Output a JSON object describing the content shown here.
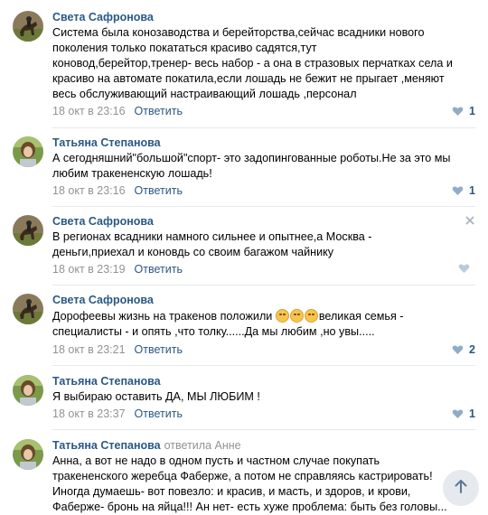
{
  "comments": [
    {
      "author": "Света Сафронова",
      "reply_to": "",
      "lines": [
        "Система была конозаводства и берейторства,сейчас всадники нового",
        "поколения только покататься красиво садятся,тут",
        "коновод,берейтор,тренер- весь набор - а она в стразовых перчатках села и",
        "красиво на автомате покатила,если лошадь не бежит не прыгает ,меняют",
        "весь обслуживающий настраивающий лошадь ,персонал"
      ],
      "date": "18 окт в 23:16",
      "reply_label": "Ответить",
      "likes": "1"
    },
    {
      "author": "Татьяна Степанова",
      "reply_to": "",
      "lines": [
        "А сегодняшний\"большой\"спорт- это задопингованные роботы.Не за это мы",
        "любим тракененскую лошадь!"
      ],
      "date": "18 окт в 23:16",
      "reply_label": "Ответить",
      "likes": "1"
    },
    {
      "author": "Света Сафронова",
      "reply_to": "",
      "lines": [
        "В регионах всадники намного сильнее и опытнее,а Москва -",
        "деньги,приехал и коновдь со своим багажом чайнику"
      ],
      "date": "18 окт в 23:19",
      "reply_label": "Ответить",
      "likes": ""
    },
    {
      "author": "Света Сафронова",
      "reply_to": "",
      "line1_before": "Дорофеевы жизнь на тракенов положили ",
      "line1_after": "великая семья -",
      "lines": [
        "специалисты - и опять ,что толку......Да мы любим ,но увы....."
      ],
      "date": "18 окт в 23:21",
      "reply_label": "Ответить",
      "likes": "2"
    },
    {
      "author": "Татьяна Степанова",
      "reply_to": "",
      "lines": [
        "Я выбираю оставить ДА, МЫ ЛЮБИМ !"
      ],
      "date": "18 окт в 23:37",
      "reply_label": "Ответить",
      "likes": "1"
    },
    {
      "author": "Татьяна Степанова",
      "reply_to": "ответила Анне",
      "lines": [
        "Анна, а вот не надо в одном пусть и частном случае покупать",
        "тракененского жеребца Фаберже, а потом не справляясь кастрировать!",
        "Иногда думаешь- вот повезло: и красив, и масть, и здоров, и крови,",
        "Фаберже- бронь на яйца!!! Ан нет- есть хуже проблема: быть без головы..."
      ],
      "date": "",
      "reply_label": "",
      "likes": ""
    }
  ],
  "colors": {
    "link": "#2a5885",
    "meta": "#939393",
    "heart": "#8fadc8",
    "divider": "#e7e8ec"
  },
  "icons": {
    "like": "heart-icon",
    "close": "close-icon",
    "scroll": "arrow-up-icon"
  }
}
